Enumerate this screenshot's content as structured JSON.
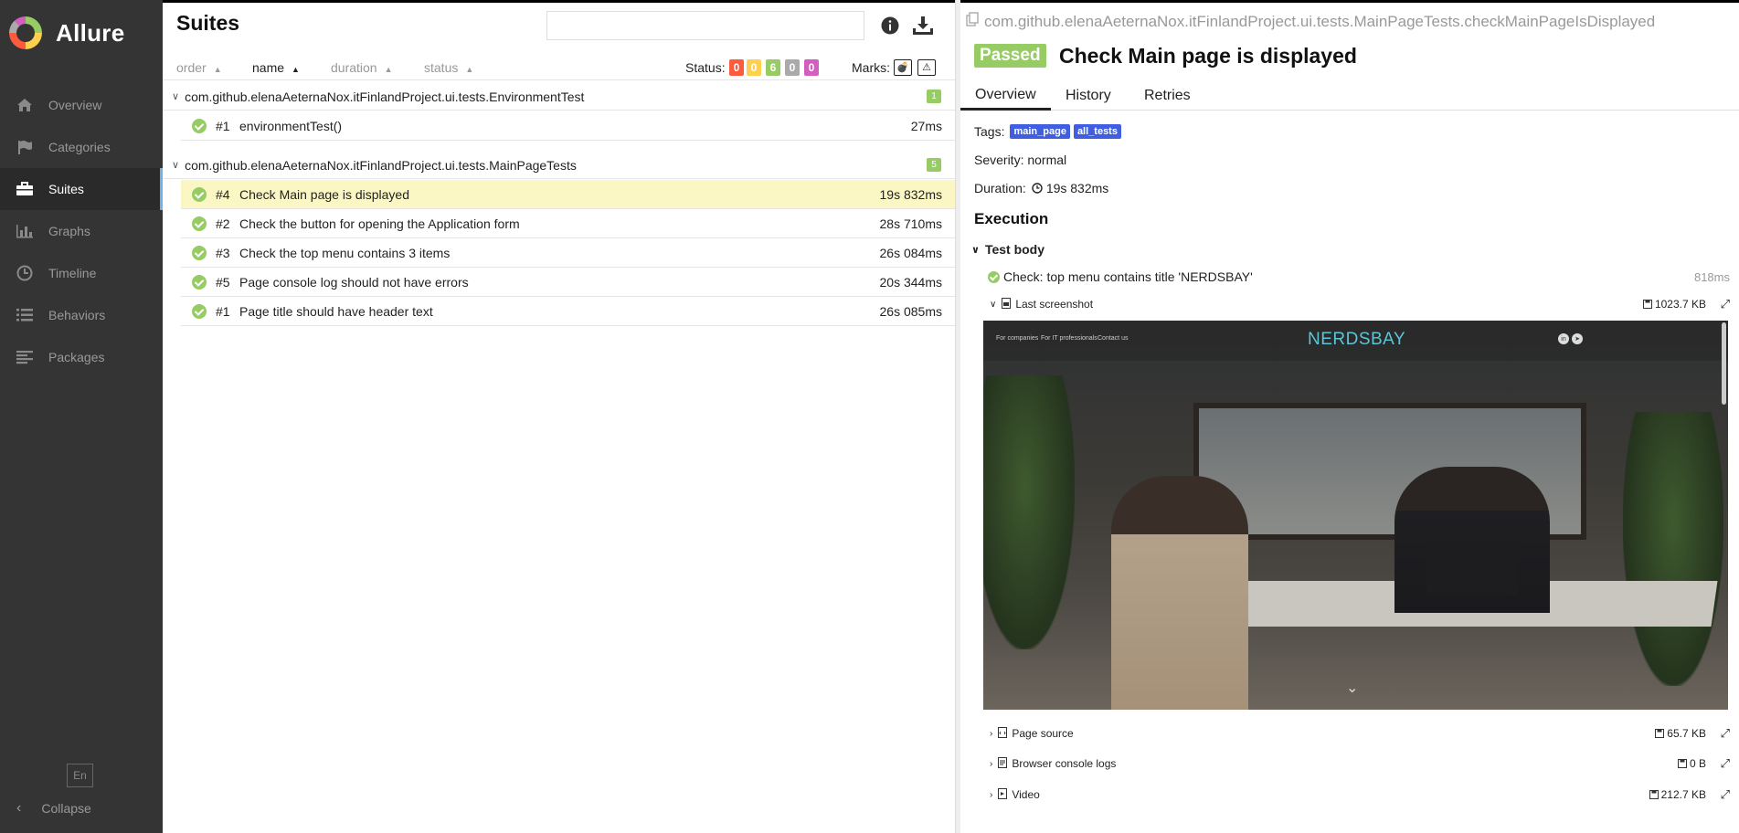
{
  "sidebar": {
    "brand": "Allure",
    "items": [
      {
        "label": "Overview",
        "icon": "home-icon"
      },
      {
        "label": "Categories",
        "icon": "flag-icon"
      },
      {
        "label": "Suites",
        "icon": "briefcase-icon"
      },
      {
        "label": "Graphs",
        "icon": "bar-chart-icon"
      },
      {
        "label": "Timeline",
        "icon": "clock-icon"
      },
      {
        "label": "Behaviors",
        "icon": "list-icon"
      },
      {
        "label": "Packages",
        "icon": "align-left-icon"
      }
    ],
    "active": "Suites",
    "lang": "En",
    "collapse": "Collapse"
  },
  "suites": {
    "title": "Suites",
    "search_placeholder": "",
    "sort": {
      "order": "order",
      "name": "name",
      "duration": "duration",
      "status": "status"
    },
    "status_label": "Status:",
    "status_counts": [
      {
        "value": "0",
        "color": "#fd5a3e"
      },
      {
        "value": "0",
        "color": "#ffd050"
      },
      {
        "value": "6",
        "color": "#97cc64"
      },
      {
        "value": "0",
        "color": "#aaaaaa"
      },
      {
        "value": "0",
        "color": "#d35ebe"
      }
    ],
    "marks_label": "Marks:",
    "groups": [
      {
        "name": "com.github.elenaAeternaNox.itFinlandProject.ui.tests.EnvironmentTest",
        "count": "1",
        "rows": [
          {
            "num": "#1",
            "name": "environmentTest()",
            "duration": "27ms"
          }
        ]
      },
      {
        "name": "com.github.elenaAeternaNox.itFinlandProject.ui.tests.MainPageTests",
        "count": "5",
        "rows": [
          {
            "num": "#4",
            "name": "Check Main page is displayed",
            "duration": "19s 832ms"
          },
          {
            "num": "#2",
            "name": "Check the button for opening the Application form",
            "duration": "28s 710ms"
          },
          {
            "num": "#3",
            "name": "Check the top menu contains 3 items",
            "duration": "26s 084ms"
          },
          {
            "num": "#5",
            "name": "Page console log should not have errors",
            "duration": "20s 344ms"
          },
          {
            "num": "#1",
            "name": "Page title should have header text",
            "duration": "26s 085ms"
          }
        ]
      }
    ]
  },
  "test": {
    "full_name": "com.github.elenaAeternaNox.itFinlandProject.ui.tests.MainPageTests.checkMainPageIsDisplayed",
    "status": "Passed",
    "title": "Check Main page is displayed",
    "tabs": [
      "Overview",
      "History",
      "Retries"
    ],
    "tags_label": "Tags:",
    "tags": [
      "main_page",
      "all_tests"
    ],
    "severity": "Severity: normal",
    "duration_label": "Duration:",
    "duration": "19s 832ms",
    "execution_title": "Execution",
    "test_body": "Test body",
    "step": {
      "name": "Check: top menu contains title 'NERDSBAY'",
      "time": "818ms"
    },
    "attachments": [
      {
        "name": "Last screenshot",
        "size": "1023.7 KB"
      },
      {
        "name": "Page source",
        "size": "65.7 KB"
      },
      {
        "name": "Browser console logs",
        "size": "0 B"
      },
      {
        "name": "Video",
        "size": "212.7 KB"
      }
    ],
    "screenshot": {
      "nav": [
        "For companies",
        "For IT professionals",
        "Contact us"
      ],
      "brand": "NERDSBAY",
      "social": [
        "in",
        "➤"
      ]
    }
  }
}
